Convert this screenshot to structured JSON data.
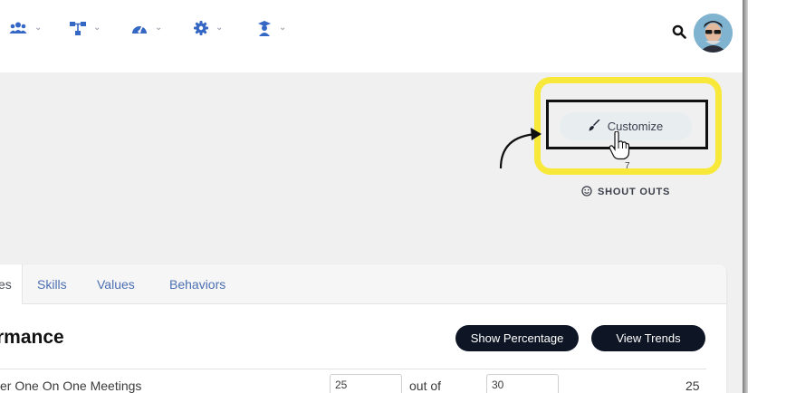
{
  "nav": {
    "items": [
      {
        "icon": "users-icon",
        "chevron": "⌄"
      },
      {
        "icon": "org-chart-icon",
        "chevron": "⌄"
      },
      {
        "icon": "dashboard-gauge-icon",
        "chevron": "⌄"
      },
      {
        "icon": "gear-icon",
        "chevron": "⌄"
      },
      {
        "icon": "graduation-cap-icon",
        "chevron": "⌄"
      }
    ],
    "accent_color": "#3567c4"
  },
  "toolbar": {
    "customize_label": "Customize",
    "shoutouts_label": "SHOUT OUTS",
    "small_mark": "7"
  },
  "highlight_color": "#f7e83a",
  "tabs": [
    {
      "label": "es",
      "active": true
    },
    {
      "label": "Skills",
      "active": false
    },
    {
      "label": "Values",
      "active": false
    },
    {
      "label": "Behaviors",
      "active": false
    }
  ],
  "section": {
    "title": "rmance",
    "show_percentage_label": "Show Percentage",
    "view_trends_label": "View Trends"
  },
  "rows": [
    {
      "label": "er One On One Meetings",
      "value": "25",
      "out_of_label": "out of",
      "target": "30",
      "score": "25"
    }
  ]
}
